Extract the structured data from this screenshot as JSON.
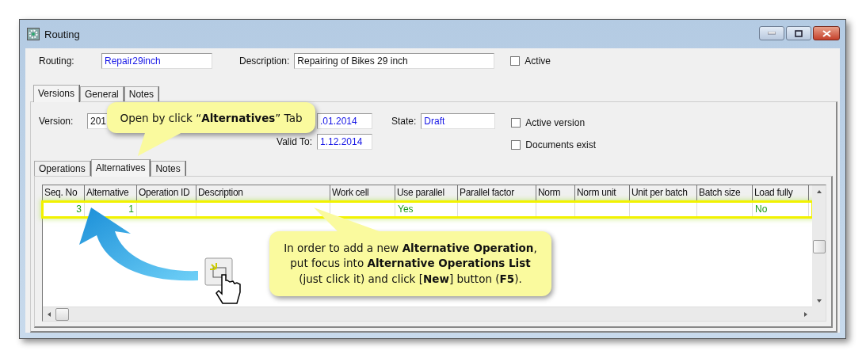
{
  "window": {
    "title": "Routing"
  },
  "header": {
    "routing_label": "Routing:",
    "routing_value": "Repair29inch",
    "description_label": "Description:",
    "description_value": "Repairing of Bikes 29 inch",
    "active": {
      "label": "Active",
      "checked": false
    }
  },
  "tabs": [
    {
      "label": "Versions",
      "selected": true
    },
    {
      "label": "General",
      "selected": false
    },
    {
      "label": "Notes",
      "selected": false
    }
  ],
  "version": {
    "version_label": "Version:",
    "version_value": "201",
    "valid_to_label": "Valid To:",
    "valid_from_value": ".01.2014",
    "valid_to_value": "1.12.2014",
    "state_label": "State:",
    "state_value": "Draft",
    "checks": [
      {
        "label": "Active version",
        "checked": false
      },
      {
        "label": "Documents exist",
        "checked": false
      }
    ]
  },
  "inner_tabs": [
    {
      "label": "Operations",
      "selected": false
    },
    {
      "label": "Alternatives",
      "selected": true
    },
    {
      "label": "Notes",
      "selected": false
    }
  ],
  "table": {
    "columns": [
      "Seq. No",
      "Alternative",
      "Operation ID",
      "Description",
      "Work cell",
      "Use parallel",
      "Parallel factor",
      "Norm",
      "Norm unit",
      "Unit per batch",
      "Batch size",
      "Load fully"
    ],
    "rows": [
      {
        "highlighted": true,
        "cells": [
          "3",
          "1",
          "",
          "",
          "",
          "Yes",
          "",
          "",
          "",
          "",
          "",
          "No"
        ]
      }
    ]
  },
  "callouts": [
    {
      "text": "Open by click “**Alternatives**” Tab"
    },
    {
      "text": "In order to add a new **Alternative Operation**, put focus into **Alternative Operations List** (just click it) and click [**New**] button (**F5**)."
    }
  ]
}
